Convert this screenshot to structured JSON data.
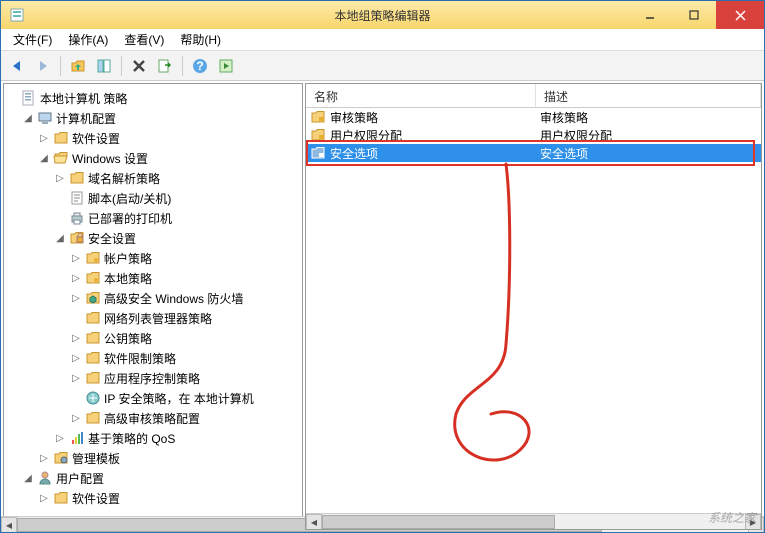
{
  "window": {
    "title": "本地组策略编辑器"
  },
  "menu": {
    "file": "文件(F)",
    "action": "操作(A)",
    "view": "查看(V)",
    "help": "帮助(H)"
  },
  "toolbar": {
    "back": "back",
    "forward": "forward",
    "up_folder": "up-folder",
    "show_hide_tree": "show-hide-tree",
    "delete": "delete",
    "export": "export-list",
    "help": "help",
    "show_hide_action": "show-hide-action"
  },
  "tree": {
    "root": "本地计算机 策略",
    "computer_config": "计算机配置",
    "software_settings": "软件设置",
    "windows_settings": "Windows 设置",
    "name_resolution": "域名解析策略",
    "scripts": "脚本(启动/关机)",
    "deployed_printers": "已部署的打印机",
    "security_settings": "安全设置",
    "account_policies": "帐户策略",
    "local_policies": "本地策略",
    "advanced_firewall": "高级安全 Windows 防火墙",
    "network_list": "网络列表管理器策略",
    "public_key": "公钥策略",
    "software_restriction": "软件限制策略",
    "app_control": "应用程序控制策略",
    "ip_security": "IP 安全策略，在 本地计算机",
    "advanced_audit": "高级审核策略配置",
    "policy_qos": "基于策略的 QoS",
    "admin_templates": "管理模板",
    "user_config": "用户配置",
    "user_software_settings": "软件设置"
  },
  "list": {
    "header_name": "名称",
    "header_desc": "描述",
    "rows": [
      {
        "name": "审核策略",
        "desc": "审核策略",
        "icon": "folder-lock",
        "selected": false
      },
      {
        "name": "用户权限分配",
        "desc": "用户权限分配",
        "icon": "folder-lock",
        "selected": false
      },
      {
        "name": "安全选项",
        "desc": "安全选项",
        "icon": "folder-lock",
        "selected": true
      }
    ],
    "highlight_row_index": 2
  },
  "colors": {
    "selection": "#2e90e8",
    "highlight_border": "#e0342a",
    "titlebar_start": "#fdeaa8",
    "titlebar_end": "#f8d66c",
    "close_button": "#d9413c"
  },
  "watermark": "系统之家"
}
